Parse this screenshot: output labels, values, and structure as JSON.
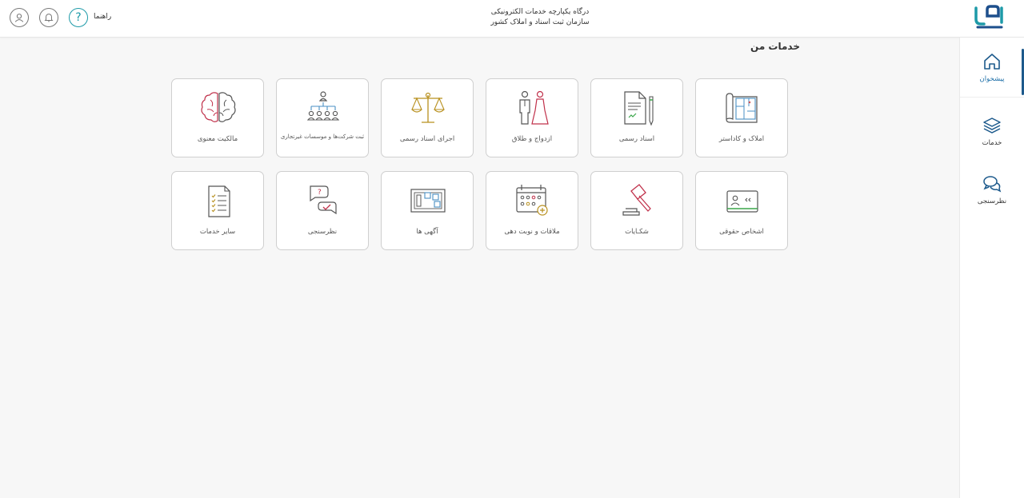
{
  "header": {
    "title_line1": "درگاه یکپارچه خدمات الکترونیکی",
    "title_line2": "سازمان ثبت اسناد و املاک کشور",
    "help_label": "راهنما"
  },
  "page": {
    "title": "خدمات من"
  },
  "sidebar": {
    "items": [
      {
        "label": "پیشخوان",
        "icon": "home-icon"
      },
      {
        "label": "خدمات",
        "icon": "layers-icon"
      },
      {
        "label": "نظرسنجی",
        "icon": "chat-bubbles-icon"
      }
    ]
  },
  "services": [
    {
      "label": "املاک و کاداستر",
      "icon": "cadastre-map-icon"
    },
    {
      "label": "اسناد رسمی",
      "icon": "document-pen-icon"
    },
    {
      "label": "ازدواج و طلاق",
      "icon": "bride-groom-icon"
    },
    {
      "label": "اجرای اسناد رسمی",
      "icon": "scales-icon"
    },
    {
      "label": "ثبت شرکت‌ها و موسسات غیرتجاری",
      "icon": "org-chart-icon"
    },
    {
      "label": "مالکیت معنوی",
      "icon": "brain-icon"
    },
    {
      "label": "اشخاص حقوقی",
      "icon": "id-card-icon"
    },
    {
      "label": "شکـایات",
      "icon": "gavel-icon"
    },
    {
      "label": "ملاقات و نوبت دهی",
      "icon": "calendar-icon"
    },
    {
      "label": "آگهی ها",
      "icon": "bulletin-board-icon"
    },
    {
      "label": "نظرسنجی",
      "icon": "survey-icon"
    },
    {
      "label": "سایر خدمات",
      "icon": "checklist-icon"
    }
  ],
  "colors": {
    "accent": "#1d9aa8",
    "sidebar_active": "#1d5a8c"
  }
}
